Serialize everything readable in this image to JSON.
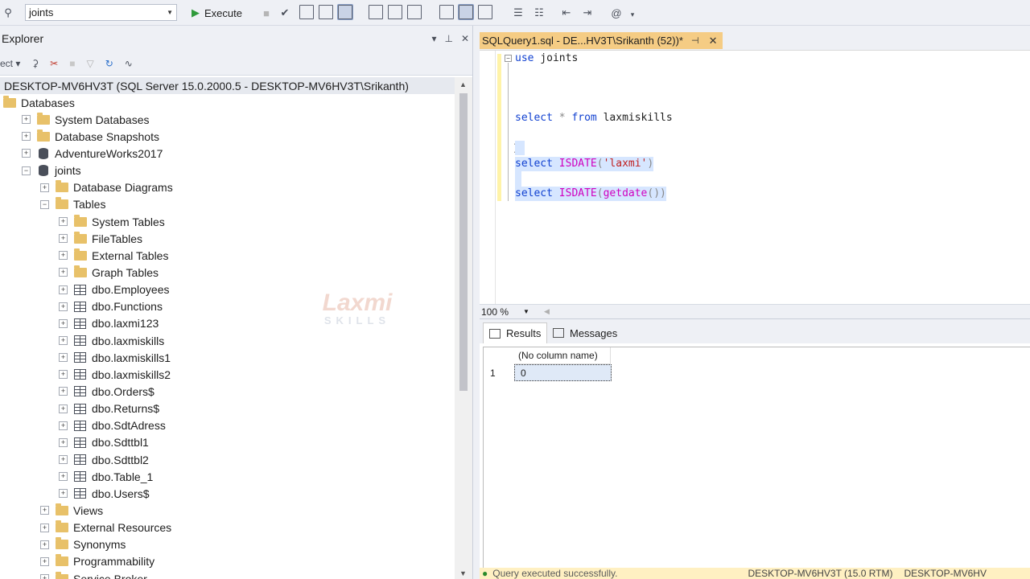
{
  "toolbar": {
    "database_value": "joints",
    "execute_label": "Execute"
  },
  "object_explorer": {
    "title": "Explorer",
    "connect_label": "ect",
    "server_node": "DESKTOP-MV6HV3T (SQL Server 15.0.2000.5 - DESKTOP-MV6HV3T\\Srikanth)",
    "nodes": [
      {
        "label": "Databases",
        "level": 0,
        "icon": "folder-icon",
        "expander": ""
      },
      {
        "label": "System Databases",
        "level": 1,
        "icon": "folder-icon",
        "expander": "+"
      },
      {
        "label": "Database Snapshots",
        "level": 1,
        "icon": "folder-icon",
        "expander": "+"
      },
      {
        "label": "AdventureWorks2017",
        "level": 1,
        "icon": "database-icon",
        "expander": "+"
      },
      {
        "label": "joints",
        "level": 1,
        "icon": "database-icon",
        "expander": "−"
      },
      {
        "label": "Database Diagrams",
        "level": 2,
        "icon": "folder-icon",
        "expander": "+"
      },
      {
        "label": "Tables",
        "level": 2,
        "icon": "folder-icon",
        "expander": "−"
      },
      {
        "label": "System Tables",
        "level": 3,
        "icon": "folder-icon",
        "expander": "+"
      },
      {
        "label": "FileTables",
        "level": 3,
        "icon": "folder-icon",
        "expander": "+"
      },
      {
        "label": "External Tables",
        "level": 3,
        "icon": "folder-icon",
        "expander": "+"
      },
      {
        "label": "Graph Tables",
        "level": 3,
        "icon": "folder-icon",
        "expander": "+"
      },
      {
        "label": "dbo.Employees",
        "level": 3,
        "icon": "table-icon",
        "expander": "+"
      },
      {
        "label": "dbo.Functions",
        "level": 3,
        "icon": "table-icon",
        "expander": "+"
      },
      {
        "label": "dbo.laxmi123",
        "level": 3,
        "icon": "table-icon",
        "expander": "+"
      },
      {
        "label": "dbo.laxmiskills",
        "level": 3,
        "icon": "table-icon",
        "expander": "+"
      },
      {
        "label": "dbo.laxmiskills1",
        "level": 3,
        "icon": "table-icon",
        "expander": "+"
      },
      {
        "label": "dbo.laxmiskills2",
        "level": 3,
        "icon": "table-icon",
        "expander": "+"
      },
      {
        "label": "dbo.Orders$",
        "level": 3,
        "icon": "table-icon",
        "expander": "+"
      },
      {
        "label": "dbo.Returns$",
        "level": 3,
        "icon": "table-icon",
        "expander": "+"
      },
      {
        "label": "dbo.SdtAdress",
        "level": 3,
        "icon": "table-icon",
        "expander": "+"
      },
      {
        "label": "dbo.Sdttbl1",
        "level": 3,
        "icon": "table-icon",
        "expander": "+"
      },
      {
        "label": "dbo.Sdttbl2",
        "level": 3,
        "icon": "table-icon",
        "expander": "+"
      },
      {
        "label": "dbo.Table_1",
        "level": 3,
        "icon": "table-icon",
        "expander": "+"
      },
      {
        "label": "dbo.Users$",
        "level": 3,
        "icon": "table-icon",
        "expander": "+"
      },
      {
        "label": "Views",
        "level": 2,
        "icon": "folder-icon",
        "expander": "+"
      },
      {
        "label": "External Resources",
        "level": 2,
        "icon": "folder-icon",
        "expander": "+"
      },
      {
        "label": "Synonyms",
        "level": 2,
        "icon": "folder-icon",
        "expander": "+"
      },
      {
        "label": "Programmability",
        "level": 2,
        "icon": "folder-icon",
        "expander": "+"
      },
      {
        "label": "Service Broker",
        "level": 2,
        "icon": "folder-icon",
        "expander": "+"
      }
    ]
  },
  "watermark": {
    "line1": "Laxmi",
    "line2": "SKILLS"
  },
  "editor": {
    "tab_title": "SQLQuery1.sql - DE...HV3T\\Srikanth (52))*",
    "lines": {
      "l1_kw": "use",
      "l1_rest": " joints",
      "l2_kw": "select",
      "l2_star": " * ",
      "l2_from": "from",
      "l2_rest": " laxmiskills",
      "l3_kw": "select",
      "l3_fn": " ISDATE",
      "l3_open": "(",
      "l3_str": "'laxmi'",
      "l3_close": ")",
      "l4_kw": "select",
      "l4_fn": " ISDATE",
      "l4_open": "(",
      "l4_fn2": "getdate",
      "l4_close": "())"
    },
    "zoom": "100 %"
  },
  "results": {
    "tab_results": "Results",
    "tab_messages": "Messages",
    "column_header": "(No column name)",
    "row_number": "1",
    "cell_value": "0"
  },
  "statusbar": {
    "message": "Query executed successfully.",
    "server": "DESKTOP-MV6HV3T (15.0 RTM)",
    "server_user": "DESKTOP-MV6HV"
  }
}
